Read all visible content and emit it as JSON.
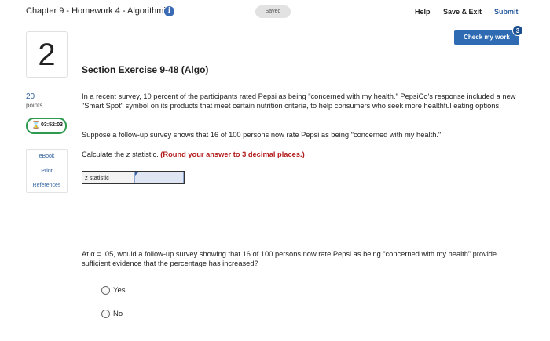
{
  "header": {
    "title": "Chapter 9 - Homework 4 - Algorithmic",
    "info_icon_glyph": "i",
    "saved_label": "Saved",
    "help_label": "Help",
    "save_exit_label": "Save & Exit",
    "submit_label": "Submit"
  },
  "check": {
    "label": "Check my work",
    "badge": "3"
  },
  "question": {
    "number": "2",
    "points_value": "20",
    "points_label": "points",
    "timer": "03:52:03",
    "title": "Section Exercise 9-48 (Algo)"
  },
  "sidebar": {
    "links": [
      "eBook",
      "Print",
      "References"
    ]
  },
  "content": {
    "para1": "In a recent survey, 10 percent of the participants rated Pepsi as being \"concerned with my health.\" PepsiCo's response included a new \"Smart Spot\" symbol on its products that meet certain nutrition criteria, to help consumers who seek more healthful eating options.",
    "para2": "Suppose a follow-up survey shows that 16 of 100 persons now rate Pepsi as being \"concerned with my health.\"",
    "para3_prefix": "Calculate the ",
    "para3_var": "z",
    "para3_mid": " statistic. ",
    "para3_instruction": "(Round your answer to 3 decimal places.)",
    "z_label": "z statistic",
    "z_value": "",
    "para4": "At α = .05, would a follow-up survey showing that 16 of 100 persons now rate Pepsi as being “concerned with my health” provide sufficient evidence that the percentage has increased?",
    "options": [
      "Yes",
      "No"
    ]
  },
  "colors": {
    "accent": "#2e6bb3",
    "timer_green": "#2e9a4f",
    "instruction_red": "#b31b1b"
  }
}
